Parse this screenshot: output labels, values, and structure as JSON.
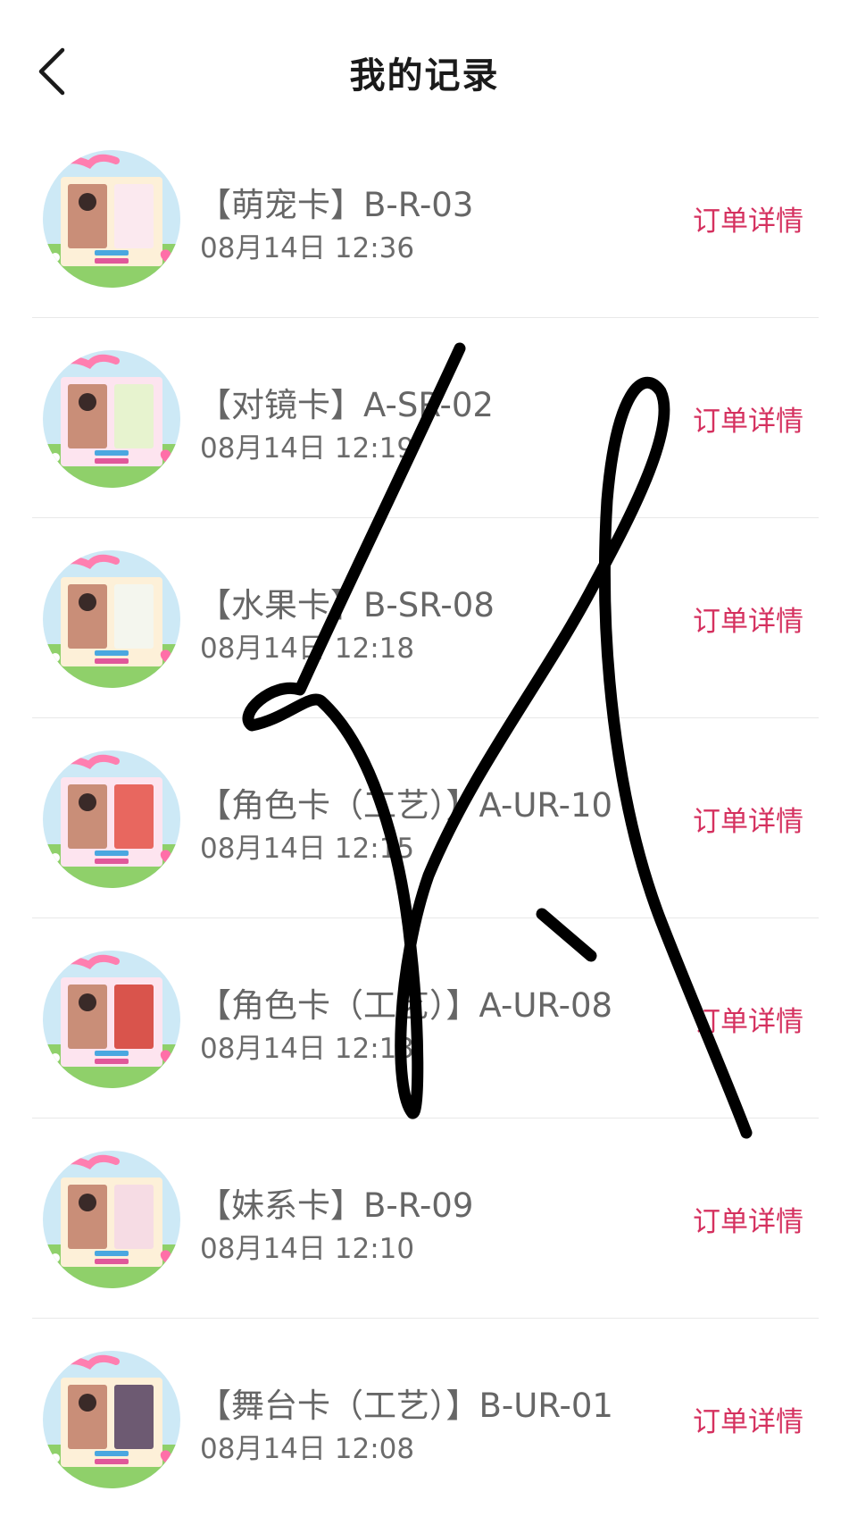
{
  "header": {
    "title": "我的记录",
    "back_icon": "chevron-left-icon"
  },
  "colors": {
    "accent": "#d5315f",
    "title": "#1a1a1a",
    "text": "#666666",
    "divider": "#e8e8e8"
  },
  "records": [
    {
      "name": "【萌宠卡】B-R-03",
      "time": "08月14日 12:36",
      "action": "订单详情",
      "card_bg": "#fdf0d8",
      "card2": "#fbe9ef"
    },
    {
      "name": "【对镜卡】A-SR-02",
      "time": "08月14日 12:19",
      "action": "订单详情",
      "card_bg": "#fde4ef",
      "card2": "#e7f3cf"
    },
    {
      "name": "【水果卡】B-SR-08",
      "time": "08月14日 12:18",
      "action": "订单详情",
      "card_bg": "#fdf0d8",
      "card2": "#f4f6ee"
    },
    {
      "name": "【角色卡（工艺）】A-UR-10",
      "time": "08月14日 12:15",
      "action": "订单详情",
      "card_bg": "#fde4ef",
      "card2": "#e8675f"
    },
    {
      "name": "【角色卡（工艺）】A-UR-08",
      "time": "08月14日 12:13",
      "action": "订单详情",
      "card_bg": "#fde4ef",
      "card2": "#d9544c"
    },
    {
      "name": "【妹系卡】B-R-09",
      "time": "08月14日 12:10",
      "action": "订单详情",
      "card_bg": "#fdf0d8",
      "card2": "#f6dce4"
    },
    {
      "name": "【舞台卡（工艺）】B-UR-01",
      "time": "08月14日 12:08",
      "action": "订单详情",
      "card_bg": "#fdf0d8",
      "card2": "#6d5a72"
    }
  ]
}
